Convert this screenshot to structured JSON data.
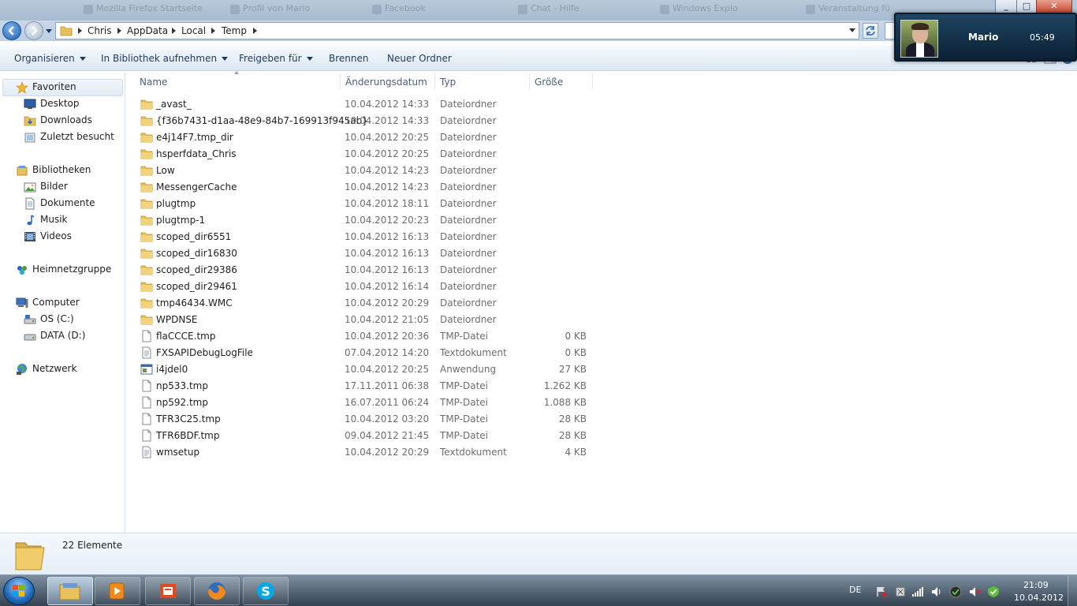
{
  "background_tabs": [
    "Mozilla Firefox Startseite",
    "Profil von Mario",
    "Facebook",
    "Chat - Hilfe",
    "Windows Explo",
    "Veranstaltung fü"
  ],
  "address": {
    "crumbs": [
      "Chris",
      "AppData",
      "Local",
      "Temp"
    ]
  },
  "toolbar": {
    "organize": "Organisieren",
    "include_library": "In Bibliothek aufnehmen",
    "share": "Freigeben für",
    "burn": "Brennen",
    "new_folder": "Neuer Ordner"
  },
  "notification": {
    "name": "Mario",
    "time": "05:49"
  },
  "nav": {
    "favorites": "Favoriten",
    "desktop": "Desktop",
    "downloads": "Downloads",
    "recent": "Zuletzt besucht",
    "libraries": "Bibliotheken",
    "pictures": "Bilder",
    "documents": "Dokumente",
    "music": "Musik",
    "videos": "Videos",
    "homegroup": "Heimnetzgruppe",
    "computer": "Computer",
    "drive_c": "OS (C:)",
    "drive_d": "DATA (D:)",
    "network": "Netzwerk"
  },
  "columns": {
    "name": "Name",
    "date": "Änderungsdatum",
    "type": "Typ",
    "size": "Größe"
  },
  "files": [
    {
      "name": "_avast_",
      "date": "10.04.2012 14:33",
      "type": "Dateiordner",
      "size": "",
      "kind": "folder"
    },
    {
      "name": "{f36b7431-d1aa-48e9-84b7-169913f945ab}",
      "date": "10.04.2012 14:33",
      "type": "Dateiordner",
      "size": "",
      "kind": "folder"
    },
    {
      "name": "e4j14F7.tmp_dir",
      "date": "10.04.2012 20:25",
      "type": "Dateiordner",
      "size": "",
      "kind": "folder"
    },
    {
      "name": "hsperfdata_Chris",
      "date": "10.04.2012 20:25",
      "type": "Dateiordner",
      "size": "",
      "kind": "folder"
    },
    {
      "name": "Low",
      "date": "10.04.2012 14:23",
      "type": "Dateiordner",
      "size": "",
      "kind": "folder"
    },
    {
      "name": "MessengerCache",
      "date": "10.04.2012 14:23",
      "type": "Dateiordner",
      "size": "",
      "kind": "folder"
    },
    {
      "name": "plugtmp",
      "date": "10.04.2012 18:11",
      "type": "Dateiordner",
      "size": "",
      "kind": "folder"
    },
    {
      "name": "plugtmp-1",
      "date": "10.04.2012 20:23",
      "type": "Dateiordner",
      "size": "",
      "kind": "folder"
    },
    {
      "name": "scoped_dir6551",
      "date": "10.04.2012 16:13",
      "type": "Dateiordner",
      "size": "",
      "kind": "folder"
    },
    {
      "name": "scoped_dir16830",
      "date": "10.04.2012 16:13",
      "type": "Dateiordner",
      "size": "",
      "kind": "folder"
    },
    {
      "name": "scoped_dir29386",
      "date": "10.04.2012 16:13",
      "type": "Dateiordner",
      "size": "",
      "kind": "folder"
    },
    {
      "name": "scoped_dir29461",
      "date": "10.04.2012 16:14",
      "type": "Dateiordner",
      "size": "",
      "kind": "folder"
    },
    {
      "name": "tmp46434.WMC",
      "date": "10.04.2012 20:29",
      "type": "Dateiordner",
      "size": "",
      "kind": "folder"
    },
    {
      "name": "WPDNSE",
      "date": "10.04.2012 21:05",
      "type": "Dateiordner",
      "size": "",
      "kind": "folder"
    },
    {
      "name": "flaCCCE.tmp",
      "date": "10.04.2012 20:36",
      "type": "TMP-Datei",
      "size": "0 KB",
      "kind": "file"
    },
    {
      "name": "FXSAPIDebugLogFile",
      "date": "07.04.2012 14:20",
      "type": "Textdokument",
      "size": "0 KB",
      "kind": "text"
    },
    {
      "name": "i4jdel0",
      "date": "10.04.2012 20:25",
      "type": "Anwendung",
      "size": "27 KB",
      "kind": "app"
    },
    {
      "name": "np533.tmp",
      "date": "17.11.2011 06:38",
      "type": "TMP-Datei",
      "size": "1.262 KB",
      "kind": "file"
    },
    {
      "name": "np592.tmp",
      "date": "16.07.2011 06:24",
      "type": "TMP-Datei",
      "size": "1.088 KB",
      "kind": "file"
    },
    {
      "name": "TFR3C25.tmp",
      "date": "10.04.2012 03:20",
      "type": "TMP-Datei",
      "size": "28 KB",
      "kind": "file"
    },
    {
      "name": "TFR6BDF.tmp",
      "date": "09.04.2012 21:45",
      "type": "TMP-Datei",
      "size": "28 KB",
      "kind": "file"
    },
    {
      "name": "wmsetup",
      "date": "10.04.2012 20:29",
      "type": "Textdokument",
      "size": "4 KB",
      "kind": "text"
    }
  ],
  "details": {
    "count": "22 Elemente"
  },
  "taskbar": {
    "language": "DE",
    "time": "21:09",
    "date": "10.04.2012"
  },
  "colors": {
    "folder": "#e8c15a",
    "accent": "#1e5fb3"
  }
}
